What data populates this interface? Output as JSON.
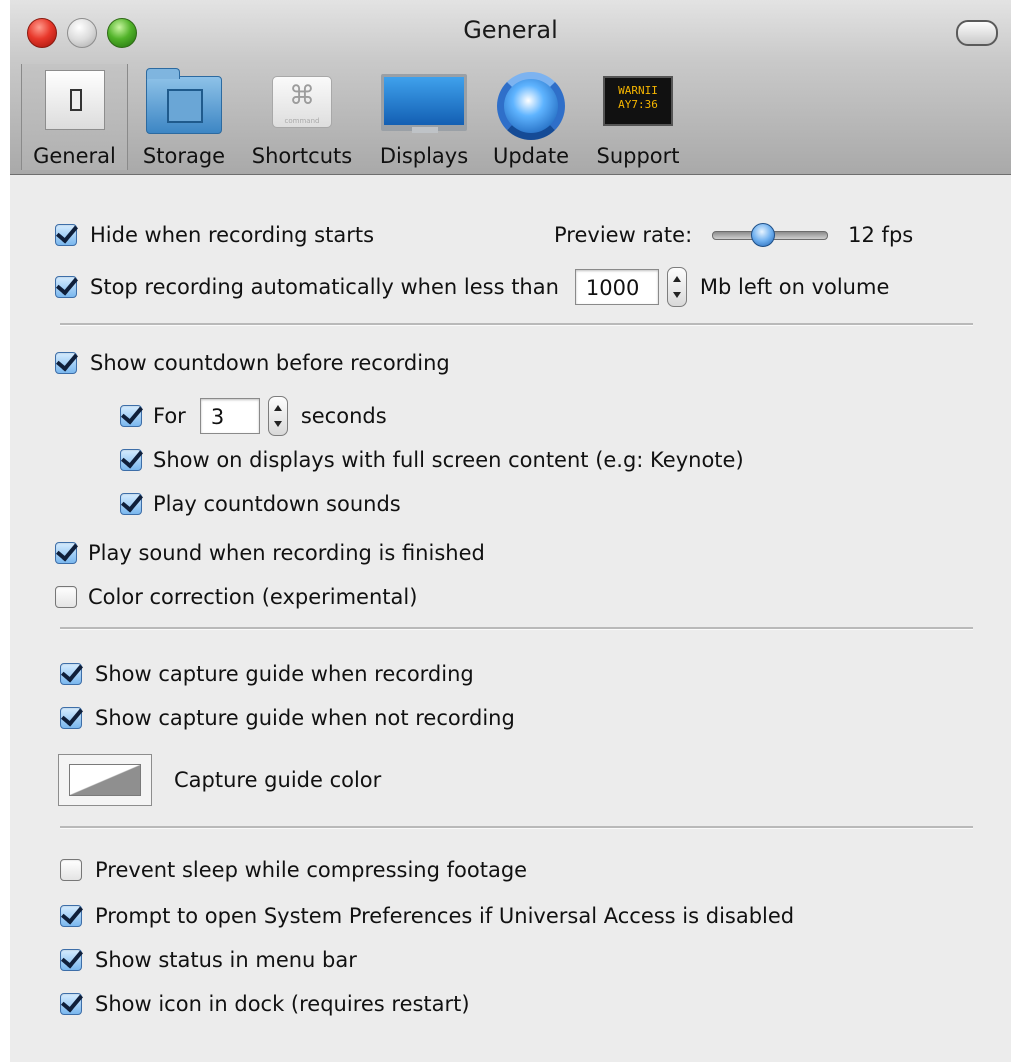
{
  "window": {
    "title": "General"
  },
  "toolbar": {
    "items": [
      {
        "label": "General",
        "icon": "switch-icon",
        "selected": true
      },
      {
        "label": "Storage",
        "icon": "film-folder-icon",
        "selected": false
      },
      {
        "label": "Shortcuts",
        "icon": "command-key-icon",
        "selected": false
      },
      {
        "label": "Displays",
        "icon": "monitor-icon",
        "selected": false
      },
      {
        "label": "Update",
        "icon": "globe-refresh-icon",
        "selected": false
      },
      {
        "label": "Support",
        "icon": "console-warning-icon",
        "selected": false
      }
    ],
    "shortcuts_icon_glyph": "⌘",
    "shortcuts_icon_caption": "command",
    "support_icon_text": "WARNII\nAY7:36"
  },
  "general": {
    "hide_when_recording": {
      "label": "Hide when recording starts",
      "checked": true
    },
    "preview_rate": {
      "label": "Preview rate:",
      "value_text": "12 fps",
      "slider_fraction": 0.44
    },
    "stop_recording": {
      "label": "Stop recording automatically when less than",
      "value": "1000",
      "suffix": "Mb left on volume",
      "checked": true
    },
    "countdown": {
      "label": "Show countdown before recording",
      "checked": true
    },
    "countdown_for": {
      "label": "For",
      "value": "3",
      "suffix": "seconds",
      "checked": true
    },
    "show_on_fullscreen": {
      "label": "Show on displays with full screen content (e.g: Keynote)",
      "checked": true
    },
    "play_countdown_sounds": {
      "label": "Play countdown sounds",
      "checked": true
    },
    "play_sound_finished": {
      "label": "Play sound when recording is finished",
      "checked": true
    },
    "color_correction": {
      "label": "Color correction (experimental)",
      "checked": false
    },
    "capture_guide_recording": {
      "label": "Show capture guide when recording",
      "checked": true
    },
    "capture_guide_not_recording": {
      "label": "Show capture guide when not recording",
      "checked": true
    },
    "capture_guide_color": {
      "label": "Capture guide color"
    },
    "prevent_sleep": {
      "label": "Prevent sleep while compressing footage",
      "checked": false
    },
    "prompt_system_prefs": {
      "label": "Prompt to open System Preferences if Universal Access is disabled",
      "checked": true
    },
    "status_menu_bar": {
      "label": "Show status in menu bar",
      "checked": true
    },
    "icon_in_dock": {
      "label": "Show icon in dock (requires restart)",
      "checked": true
    }
  },
  "colors": {
    "accent": "#3d86c4",
    "background": "#ececec"
  }
}
